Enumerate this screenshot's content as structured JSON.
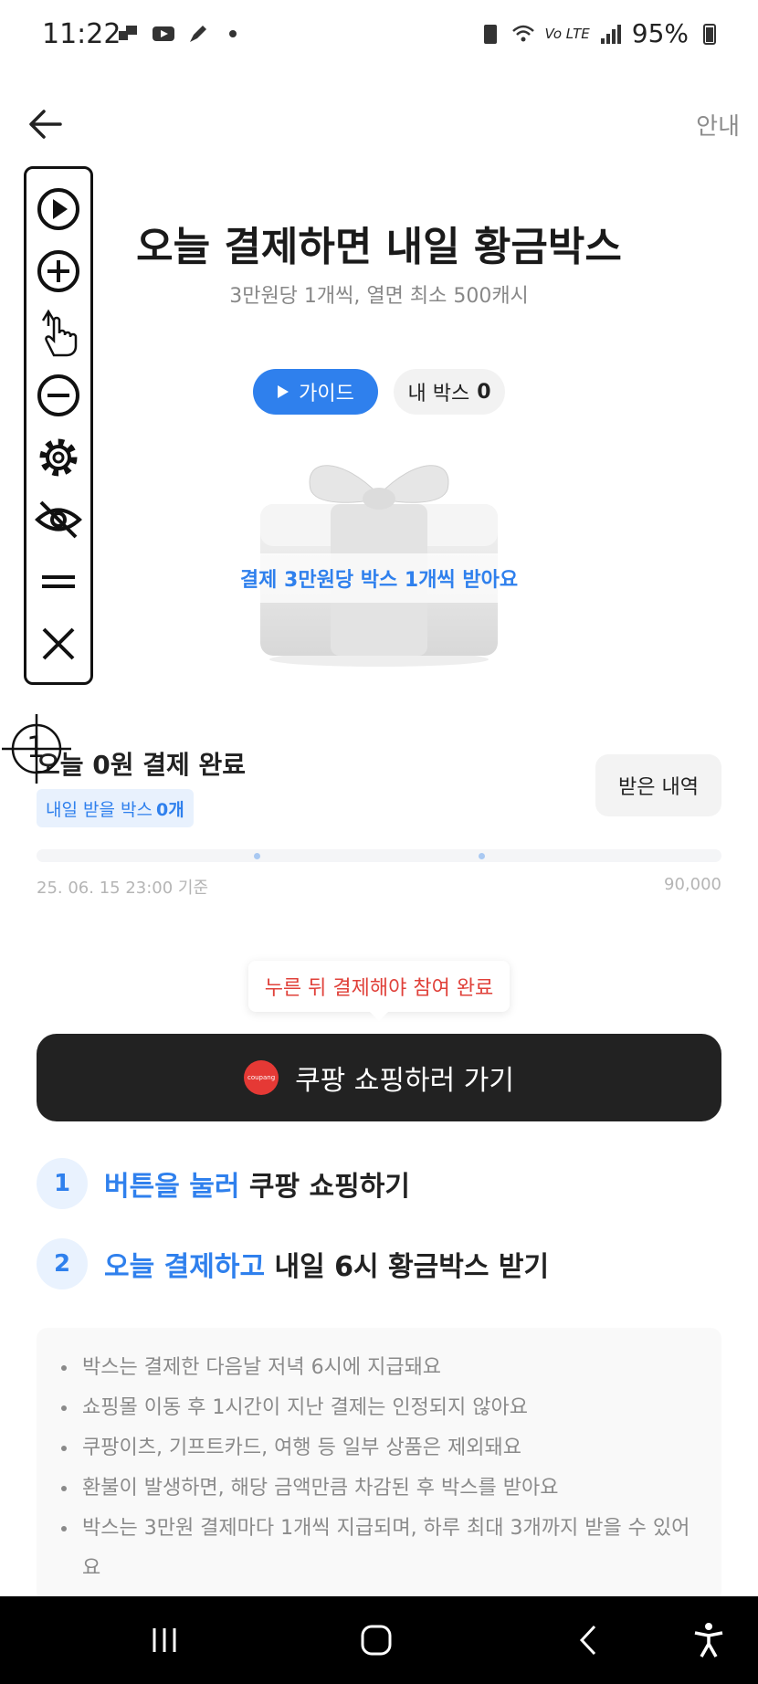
{
  "status_bar": {
    "time": "11:22",
    "network": "Vo LTE",
    "battery": "95%"
  },
  "header": {
    "help_label": "안내",
    "title": "오늘 결제하면 내일 황금박스",
    "subtitle": "3만원당 1개씩, 열면 최소 500캐시"
  },
  "buttons": {
    "guide_label": "가이드",
    "mybox_label": "내 박스",
    "mybox_count": "0",
    "history_label": "받은 내역"
  },
  "gift": {
    "caption": "결제 3만원당 박스 1개씩 받아요"
  },
  "payment": {
    "status": "오늘 0원 결제 완료",
    "tomorrow_prefix": "내일 받을 박스",
    "tomorrow_count": "0개",
    "progress_fraction": 0,
    "timestamp": "25. 06. 15 23:00 기준",
    "goal": "90,000"
  },
  "crosshair_label": "1",
  "cta": {
    "tooltip": "누른 뒤 결제해야 참여 완료",
    "logo_text": "coupang",
    "label": "쿠팡 쇼핑하러 가기"
  },
  "steps": [
    {
      "num": "1",
      "highlight": "버튼을 눌러",
      "rest": " 쿠팡 쇼핑하기"
    },
    {
      "num": "2",
      "highlight": "오늘 결제하고",
      "rest": " 내일 6시 황금박스 받기"
    }
  ],
  "notices": [
    "박스는 결제한 다음날 저녁 6시에 지급돼요",
    "쇼핑몰 이동 후 1시간이 지난 결제는 인정되지 않아요",
    "쿠팡이츠, 기프트카드, 여행 등 일부 상품은 제외돼요",
    "환불이 발생하면, 해당 금액만큼 차감된 후 박스를 받아요",
    "박스는 3만원 결제마다 1개씩 지급되며, 하루 최대 3개까지 받을 수 있어요"
  ],
  "colors": {
    "accent": "#2f80ed",
    "cta_bg": "#222222",
    "tooltip_text": "#e0413a"
  }
}
